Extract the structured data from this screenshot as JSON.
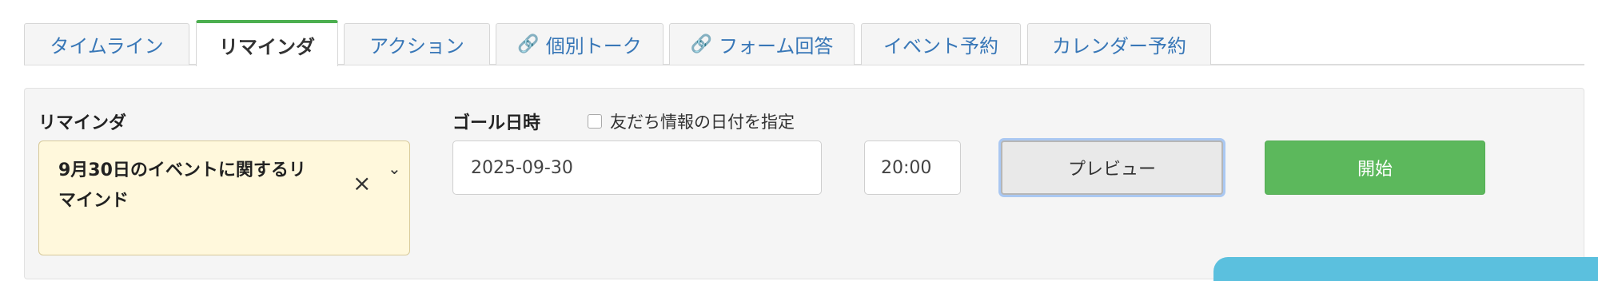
{
  "tabs": [
    {
      "label": "タイムライン",
      "active": false,
      "link": false
    },
    {
      "label": "リマインダ",
      "active": true,
      "link": false
    },
    {
      "label": "アクション",
      "active": false,
      "link": false
    },
    {
      "label": "個別トーク",
      "active": false,
      "link": true
    },
    {
      "label": "フォーム回答",
      "active": false,
      "link": true
    },
    {
      "label": "イベント予約",
      "active": false,
      "link": false
    },
    {
      "label": "カレンダー予約",
      "active": false,
      "link": false
    }
  ],
  "form": {
    "reminder_label": "リマインダ",
    "reminder_value": "9月30日のイベントに関するリマインド",
    "goal_label": "ゴール日時",
    "use_friend_date_label": "友だち情報の日付を指定",
    "date_value": "2025-09-30",
    "time_value": "20:00",
    "preview_label": "プレビュー",
    "start_label": "開始"
  },
  "colors": {
    "active_tab_accent": "#4caf50",
    "tab_text": "#3877b7",
    "select_background": "#fff8dc",
    "start_button": "#5cb85c",
    "preview_focus": "#aac8f2"
  },
  "icons": {
    "link": "link-icon",
    "clear": "close-icon",
    "dropdown": "chevron-down-icon"
  }
}
